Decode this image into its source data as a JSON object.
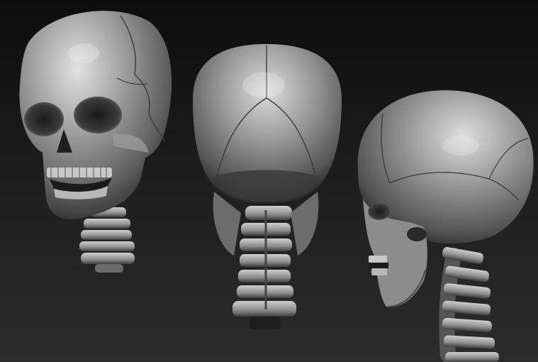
{
  "scene": {
    "subject": "skull-and-cervical-spine-sculpt",
    "views": [
      {
        "id": "front-three-quarter",
        "icon": "skull-front-view"
      },
      {
        "id": "back",
        "icon": "skull-back-view"
      },
      {
        "id": "side",
        "icon": "skull-side-view"
      }
    ],
    "colors": {
      "background_top": "#0d0d0d",
      "background_bottom": "#2c2c2c",
      "bone_highlight": "#d8d8d8",
      "bone_mid": "#8a8a8a",
      "bone_shadow": "#2a2a2a",
      "suture_line": "#3a3a3a"
    }
  }
}
